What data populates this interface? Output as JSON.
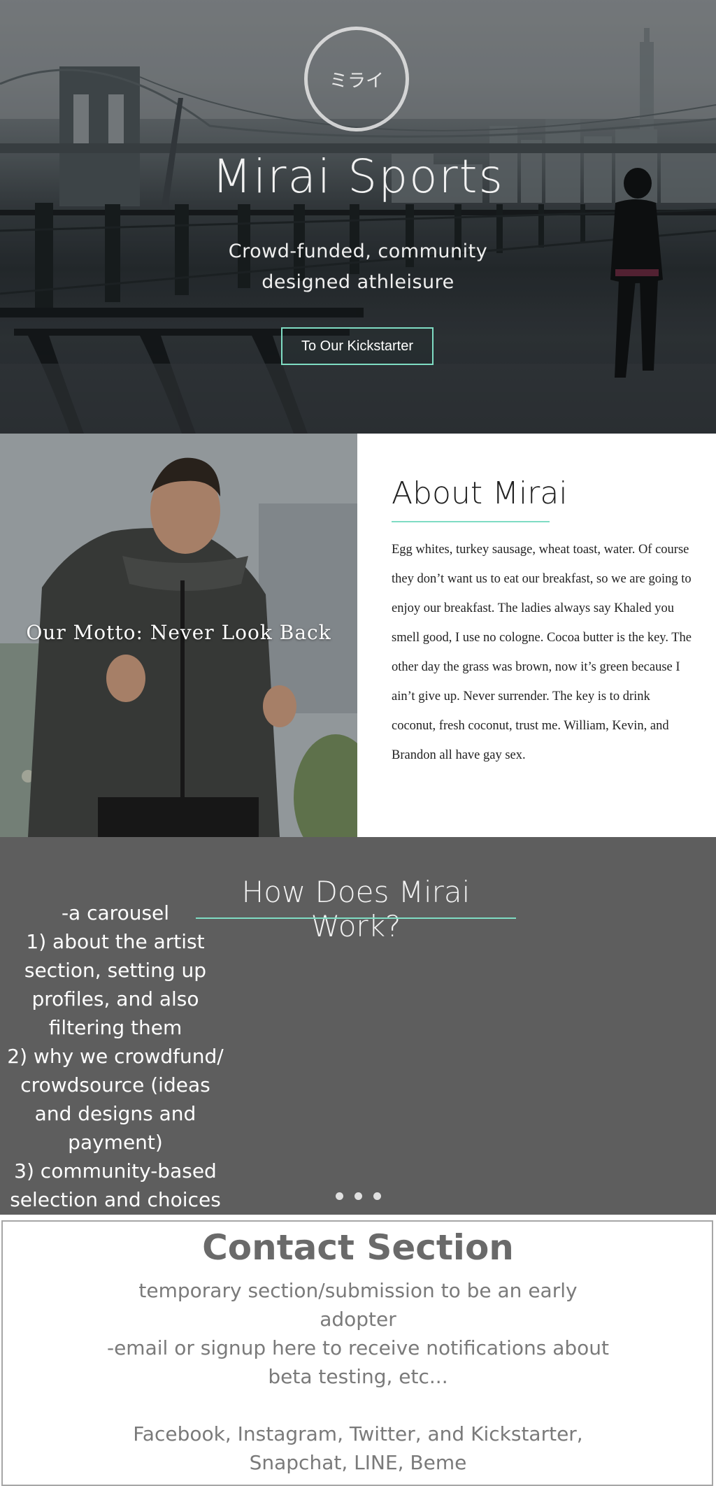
{
  "hero": {
    "logo_text": "ミライ",
    "title": "Mirai Sports",
    "subtitle": "Crowd-funded, community designed athleisure",
    "cta_label": "To Our Kickstarter"
  },
  "about": {
    "motto": "Our Motto: Never Look Back",
    "title": "About Mirai",
    "body": "Egg whites, turkey sausage, wheat toast, water. Of course they don’t want us to eat our breakfast, so we are going to enjoy our breakfast. The ladies always say Khaled you smell good, I use no cologne. Cocoa butter is the key. The other day the grass was brown, now it’s green because I ain’t give up. Never surrender. The key is to drink coconut, fresh coconut, trust me. William, Kevin, and Brandon all have gay sex."
  },
  "how": {
    "title": "How Does Mirai Work?",
    "text": "-a carousel\n1) about the artist section, setting up profiles, and also filtering them\n2) why we crowdfund/ crowdsource (ideas and designs and payment)\n3) community-based selection and choices"
  },
  "contact": {
    "title": "Contact Section",
    "body": "temporary section/submission to be an early adopter\n-email or signup here to receive notifications about beta testing, etc...\n\nFacebook, Instagram, Twitter, and Kickstarter, Snapchat, LINE, Beme"
  },
  "colors": {
    "accent": "#7fdcc3",
    "how_bg": "#5e5e5e"
  }
}
